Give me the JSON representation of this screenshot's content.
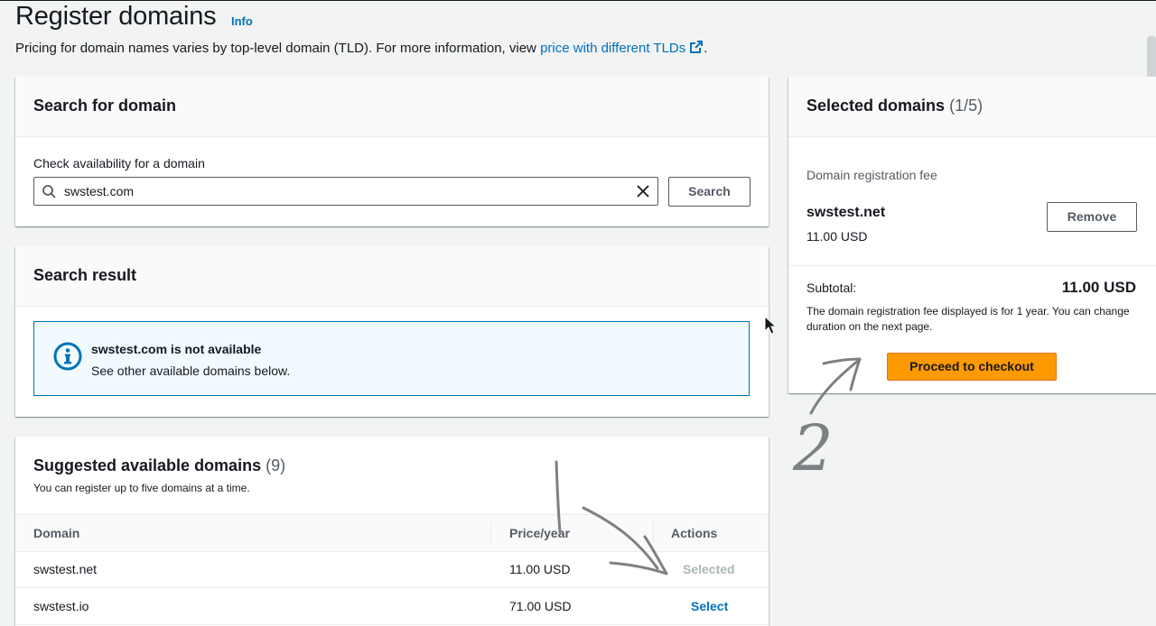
{
  "header": {
    "title": "Register domains",
    "info_link": "Info",
    "description_prefix": "Pricing for domain names varies by top-level domain (TLD). For more information, view",
    "description_link": "price with different TLDs",
    "description_suffix": "."
  },
  "search_panel": {
    "title": "Search for domain",
    "field_label": "Check availability for a domain",
    "search_value": "swstest.com",
    "search_button": "Search"
  },
  "result_panel": {
    "title": "Search result",
    "alert_title": "swstest.com is not available",
    "alert_body": "See other available domains below."
  },
  "suggested_panel": {
    "title": "Suggested available domains",
    "count": "(9)",
    "subtitle": "You can register up to five domains at a time.",
    "columns": [
      "Domain",
      "Price/year",
      "Actions"
    ],
    "rows": [
      {
        "domain": "swstest.net",
        "price": "11.00 USD",
        "action": "Selected"
      },
      {
        "domain": "swstest.io",
        "price": "71.00 USD",
        "action": "Select"
      }
    ]
  },
  "selected_panel": {
    "title": "Selected domains",
    "count": "(1/5)",
    "fee_label": "Domain registration fee",
    "domain": "swstest.net",
    "price": "11.00 USD",
    "remove_button": "Remove",
    "subtotal_label": "Subtotal:",
    "subtotal_value": "11.00 USD",
    "note": "The domain registration fee displayed is for 1 year. You can change duration on the next page.",
    "checkout_button": "Proceed to checkout"
  },
  "annotations": {
    "handwritten_number": "2"
  },
  "colors": {
    "link": "#0073bb",
    "primary_button": "#ff9900",
    "info_alert_bg": "#f1faff",
    "disabled_text": "#aab7b8"
  },
  "icons": {
    "info": "info-link",
    "external_link": "external-link-icon",
    "search": "search-icon",
    "clear": "close-icon",
    "alert": "info-circle-icon"
  }
}
